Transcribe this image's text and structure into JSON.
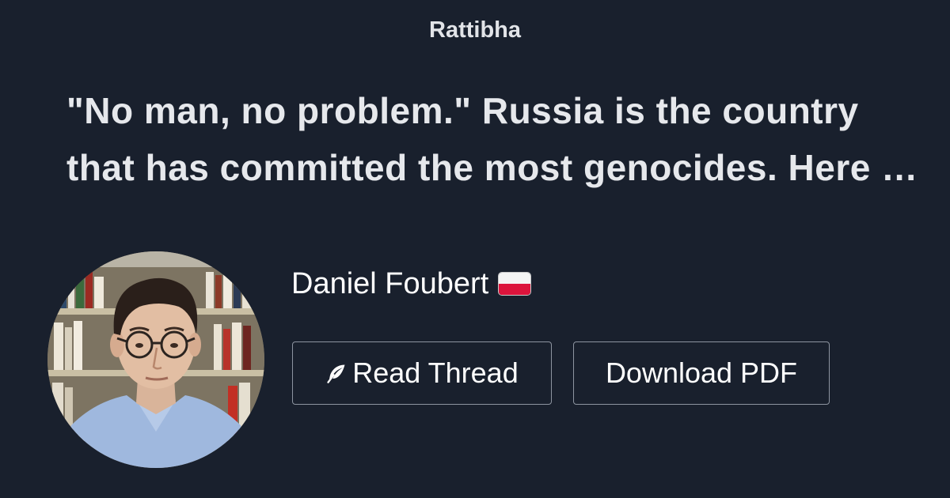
{
  "site": {
    "name": "Rattibha"
  },
  "thread": {
    "title": "\"No man, no problem.\" Russia is the country that has committed the most genocides. Here is a thread about the genocides committed by Russia."
  },
  "author": {
    "name": "Daniel Foubert",
    "flag_icon": "poland-flag-icon"
  },
  "actions": {
    "read_label": "Read Thread",
    "read_icon": "feather-icon",
    "pdf_label": "Download PDF"
  },
  "colors": {
    "background": "#19202d",
    "text": "#e6e8ec",
    "button_border": "#8d94a0"
  }
}
